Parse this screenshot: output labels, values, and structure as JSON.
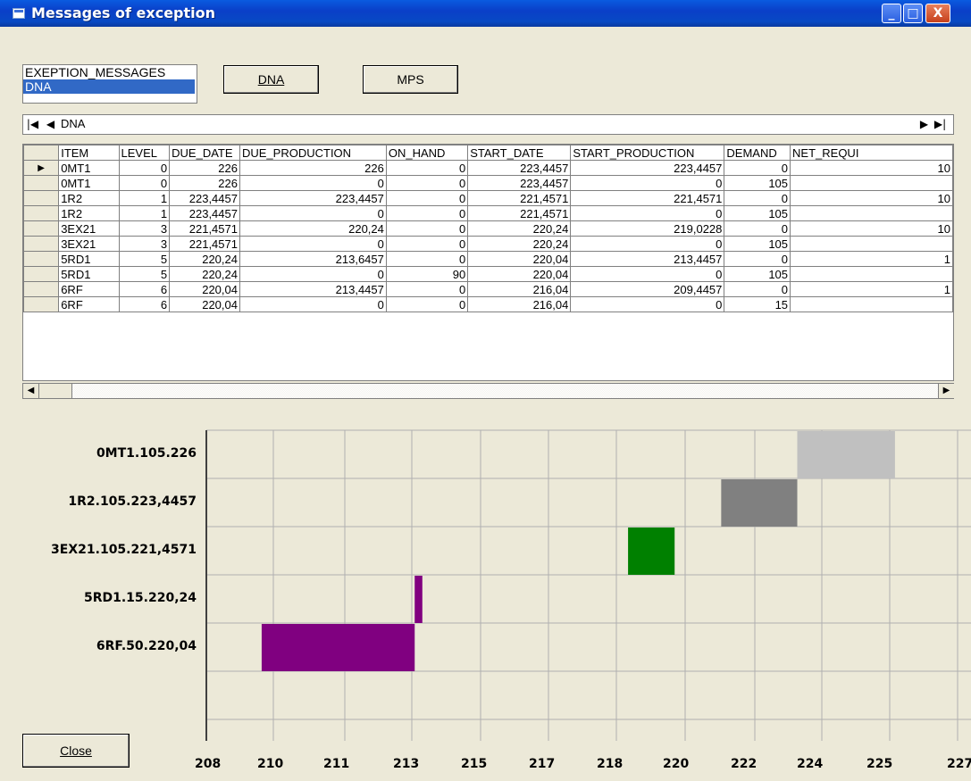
{
  "window": {
    "title": "Messages of exception",
    "minimize": "_",
    "maximize": "□",
    "close": "X"
  },
  "list": {
    "items": [
      "EXEPTION_MESSAGES",
      "DNA"
    ],
    "selected": "DNA"
  },
  "buttons": {
    "dna": "DNA",
    "mps": "MPS",
    "close": "Close"
  },
  "navigator": {
    "caption": "DNA",
    "first": "⏮",
    "prev": "◀",
    "next": "▶",
    "last": "⏭"
  },
  "grid": {
    "columns": [
      "ITEM",
      "LEVEL",
      "DUE_DATE",
      "DUE_PRODUCTION",
      "ON_HAND",
      "START_DATE",
      "START_PRODUCTION",
      "DEMAND",
      "NET_REQUI"
    ],
    "rows": [
      [
        "0MT1",
        "0",
        "226",
        "226",
        "0",
        "223,4457",
        "223,4457",
        "0",
        "10"
      ],
      [
        "0MT1",
        "0",
        "226",
        "0",
        "0",
        "223,4457",
        "0",
        "105",
        ""
      ],
      [
        "1R2",
        "1",
        "223,4457",
        "223,4457",
        "0",
        "221,4571",
        "221,4571",
        "0",
        "10"
      ],
      [
        "1R2",
        "1",
        "223,4457",
        "0",
        "0",
        "221,4571",
        "0",
        "105",
        ""
      ],
      [
        "3EX21",
        "3",
        "221,4571",
        "220,24",
        "0",
        "220,24",
        "219,0228",
        "0",
        "10"
      ],
      [
        "3EX21",
        "3",
        "221,4571",
        "0",
        "0",
        "220,24",
        "0",
        "105",
        ""
      ],
      [
        "5RD1",
        "5",
        "220,24",
        "213,6457",
        "0",
        "220,04",
        "213,4457",
        "0",
        "1"
      ],
      [
        "5RD1",
        "5",
        "220,24",
        "0",
        "90",
        "220,04",
        "0",
        "105",
        ""
      ],
      [
        "6RF",
        "6",
        "220,04",
        "213,4457",
        "0",
        "216,04",
        "209,4457",
        "0",
        "1"
      ],
      [
        "6RF",
        "6",
        "220,04",
        "0",
        "0",
        "216,04",
        "0",
        "15",
        ""
      ]
    ]
  },
  "chart_data": {
    "type": "gantt",
    "rows": [
      "0MT1.105.226",
      "1R2.105.223,4457",
      "3EX21.105.221,4571",
      "5RD1.15.220,24",
      "6RF.50.220,04"
    ],
    "bars": [
      {
        "row": 0,
        "start": 223.4457,
        "end": 226,
        "color": "#c0c0c0"
      },
      {
        "row": 1,
        "start": 221.4571,
        "end": 223.4457,
        "color": "#808080"
      },
      {
        "row": 2,
        "start": 219.0228,
        "end": 220.24,
        "color": "#008000"
      },
      {
        "row": 3,
        "start": 213.4457,
        "end": 213.6457,
        "color": "#800080"
      },
      {
        "row": 4,
        "start": 209.4457,
        "end": 213.4457,
        "color": "#800080"
      }
    ],
    "ticks": [
      "208",
      "210",
      "211",
      "213",
      "215",
      "217",
      "218",
      "220",
      "222",
      "224",
      "225",
      "227"
    ],
    "xlim": [
      208.0,
      227.8
    ],
    "grid": true
  }
}
